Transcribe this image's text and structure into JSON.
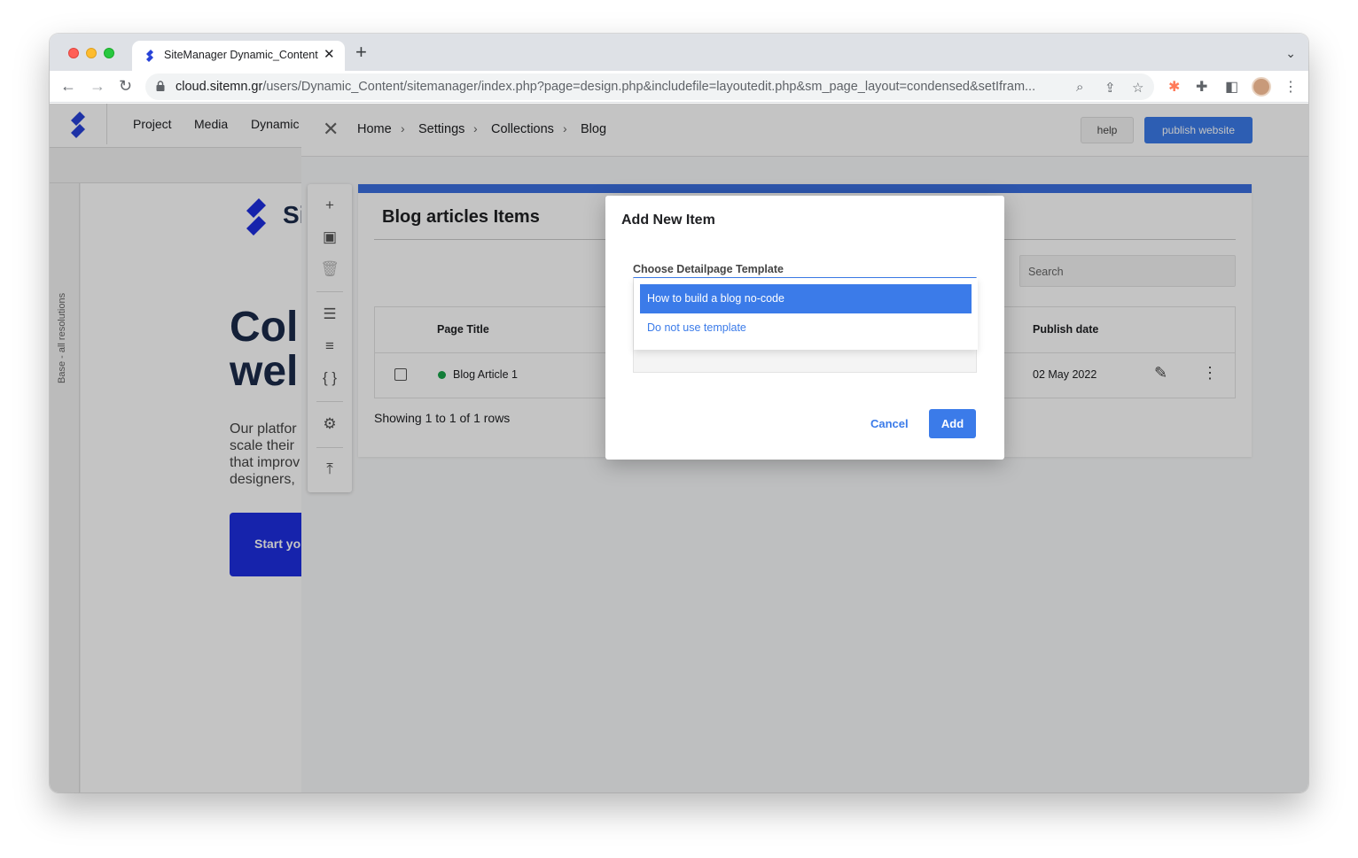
{
  "browser": {
    "tab_title": "SiteManager Dynamic_Content",
    "url_host": "cloud.sitemn.gr",
    "url_path": "/users/Dynamic_Content/sitemanager/index.php?page=design.php&includefile=layoutedit.php&sm_page_layout=condensed&setIfram..."
  },
  "app_nav": {
    "project": "Project",
    "media": "Media",
    "dynamic": "Dynamic"
  },
  "side_strip": {
    "label": "Base - all resolutions"
  },
  "preview": {
    "logo_text": "Si",
    "heading_line1": "Col",
    "heading_line2": "wel",
    "para_line1": "Our platfor",
    "para_line2": "scale their",
    "para_line3": "that improv",
    "para_line4": "designers, ",
    "cta": "Start yo"
  },
  "breadcrumb": [
    "Home",
    "Settings",
    "Collections",
    "Blog"
  ],
  "header_buttons": {
    "help": "help",
    "publish": "publish website"
  },
  "card": {
    "title": "Blog articles Items",
    "search_placeholder": "Search",
    "columns": {
      "page_title": "Page Title",
      "publish_date": "Publish date"
    },
    "rows": [
      {
        "page_title": "Blog Article 1",
        "publish_date": "02 May 2022",
        "status": "published"
      }
    ],
    "footer": "Showing 1 to 1 of 1 rows"
  },
  "modal": {
    "title": "Add New Item",
    "field_label": "Choose Detailpage Template",
    "options": [
      "How to build a blog no-code",
      "Do not use template"
    ],
    "selected_option": "How to build a blog no-code",
    "cancel": "Cancel",
    "add": "Add"
  },
  "colors": {
    "accent": "#3b7be9",
    "brand_dark": "#1b2a4a",
    "cta_blue": "#1d2ee0",
    "status_green": "#18a34a"
  }
}
